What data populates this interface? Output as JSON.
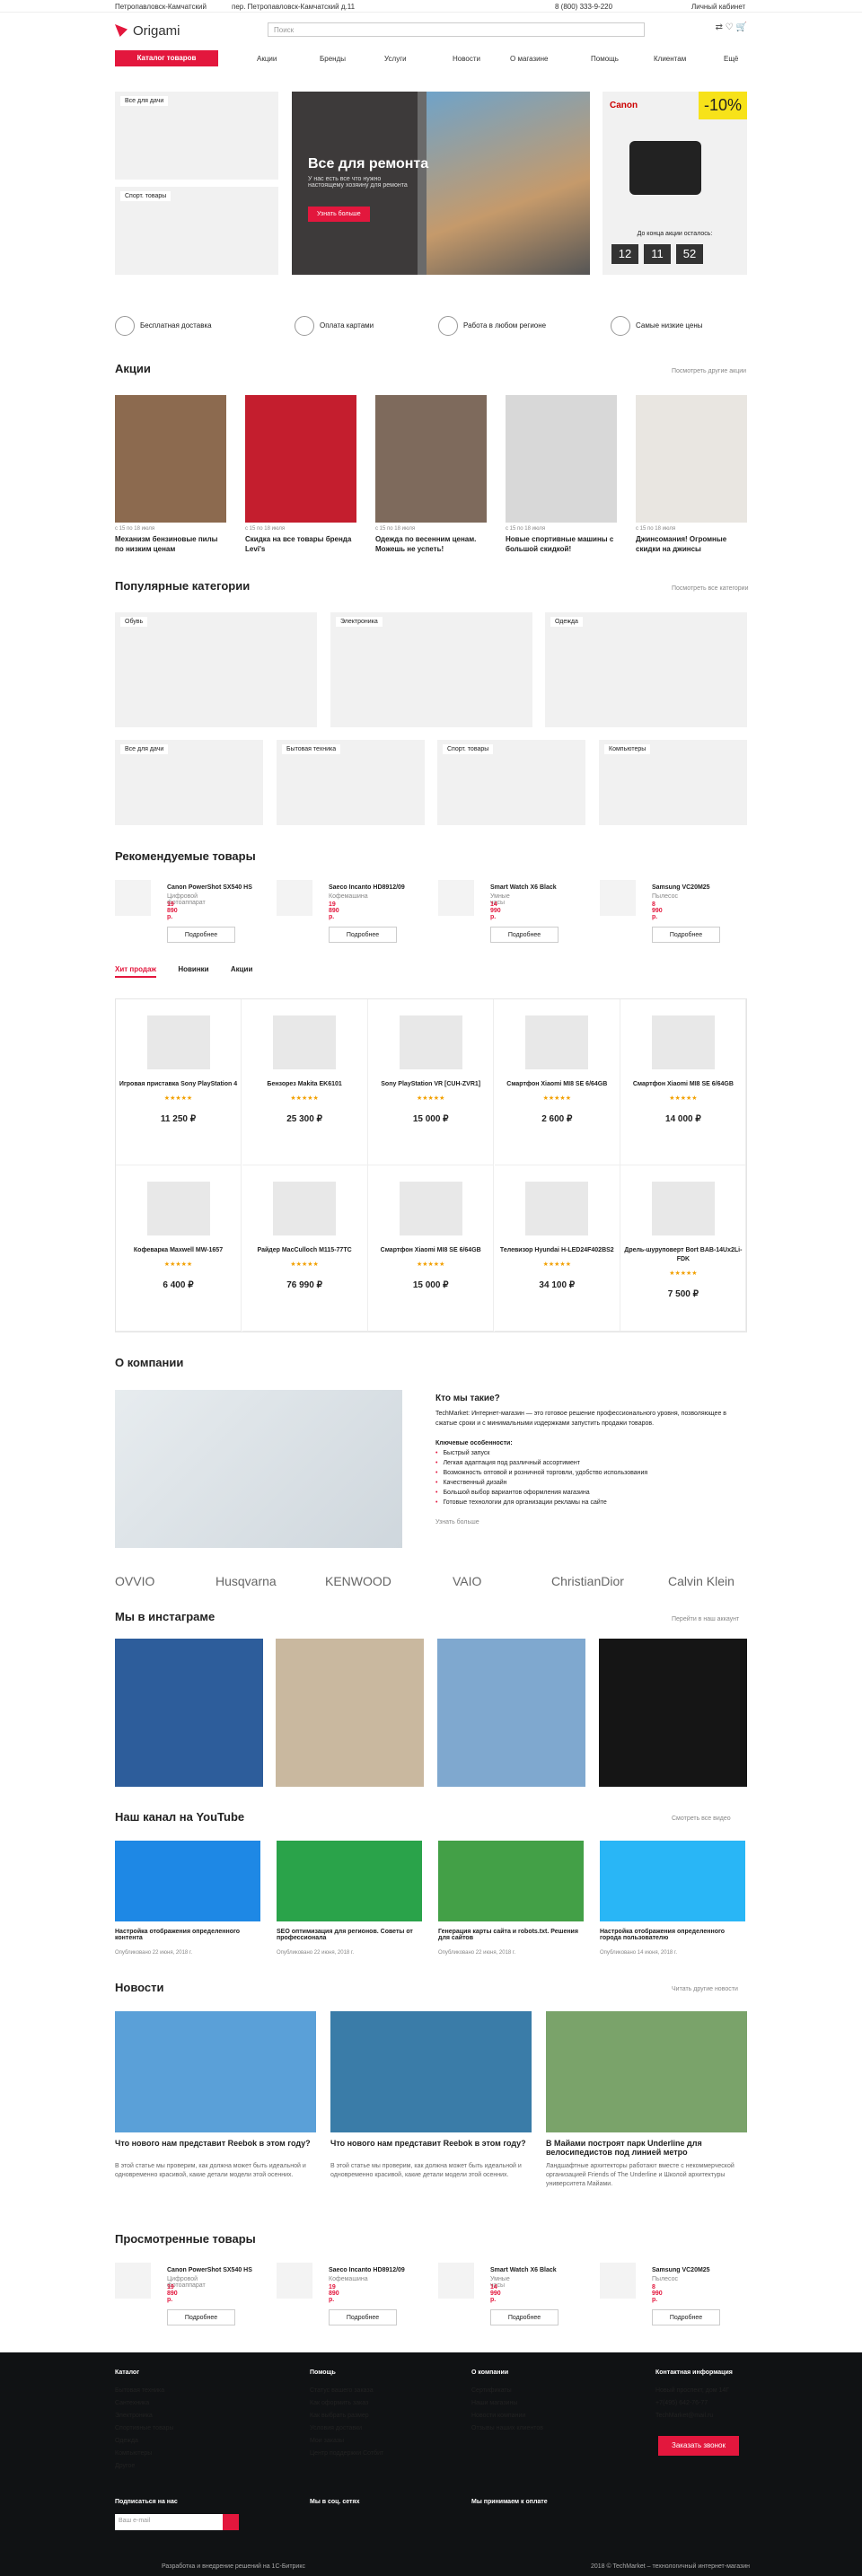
{
  "topbar": {
    "city": "Петропавловск-Камчатский",
    "address": "пер. Петропавловск-Камчатский д.11",
    "phone": "8 (800) 333-9-220",
    "cabinet": "Личный кабинет"
  },
  "header": {
    "logo": "Origami",
    "search_placeholder": "Поиск"
  },
  "nav": {
    "catalog": "Каталог товаров",
    "items": [
      "Акции",
      "Бренды",
      "Услуги",
      "Новости",
      "О магазине",
      "Помощь",
      "Клиентам",
      "Ещё"
    ]
  },
  "banners": {
    "garden": "Все для дачи",
    "sport": "Спорт. товары",
    "hero_title": "Все для ремонта",
    "hero_text": "У нас есть все что нужно настоящему хозяину для ремонта",
    "hero_btn": "Узнать больше",
    "promo_pct": "-10%",
    "promo_brand": "Canon",
    "promo_caption": "До конца акции осталось:",
    "timer": [
      "12",
      "11",
      "52"
    ],
    "timer_labels": [
      "Часов",
      "Минуты",
      "Секунды"
    ]
  },
  "features": [
    "Бесплатная доставка",
    "Оплата картами",
    "Работа в любом регионе",
    "Самые низкие цены"
  ],
  "promos": {
    "title": "Акции",
    "more": "Посмотреть другие акции",
    "items": [
      {
        "date": "с 15 по 18 июля",
        "title": "Механизм бензиновые пилы по низким ценам",
        "color": "#8c6a4f"
      },
      {
        "date": "с 15 по 18 июля",
        "title": "Скидка на все товары бренда Levi's",
        "color": "#c41e2e"
      },
      {
        "date": "с 15 по 18 июля",
        "title": "Одежда по весенним ценам. Можешь не успеть!",
        "color": "#7e6a5c"
      },
      {
        "date": "с 15 по 18 июля",
        "title": "Новые спортивные машины с большой скидкой!",
        "color": "#d8d8d8"
      },
      {
        "date": "с 15 по 18 июля",
        "title": "Джинсомания! Огромные скидки на джинсы",
        "color": "#e9e6e1"
      }
    ]
  },
  "categories": {
    "title": "Популярные категории",
    "more": "Посмотреть все категории",
    "big": [
      "Обувь",
      "Электроника",
      "Одежда"
    ],
    "small": [
      "Все для дачи",
      "Бытовая техника",
      "Спорт. товары",
      "Компьютеры"
    ]
  },
  "recommended": {
    "title": "Рекомендуемые товары",
    "btn": "Подробнее",
    "items": [
      {
        "name": "Canon PowerShot SX540 HS",
        "cat": "Цифровой фотоаппарат",
        "price": "19 890 р."
      },
      {
        "name": "Saeco Incanto HD8912/09",
        "cat": "Кофемашина",
        "price": "19 890 р."
      },
      {
        "name": "Smart Watch X6 Black",
        "cat": "Умные часы",
        "price": "14 990 р."
      },
      {
        "name": "Samsung VC20M25",
        "cat": "Пылесос",
        "price": "8 990 р."
      }
    ]
  },
  "tabs": [
    "Хит продаж",
    "Новинки",
    "Акции"
  ],
  "products": [
    {
      "name": "Игровая приставка Sony PlayStation 4",
      "price": "11 250 ₽"
    },
    {
      "name": "Бензорез Makita EK6101",
      "price": "25 300 ₽"
    },
    {
      "name": "Sony PlayStation VR [CUH-ZVR1]",
      "price": "15 000 ₽"
    },
    {
      "name": "Смартфон Xiaomi MI8 SE 6/64GB",
      "price": "2 600 ₽"
    },
    {
      "name": "Смартфон Xiaomi MI8 SE 6/64GB",
      "price": "14 000 ₽"
    },
    {
      "name": "Кофеварка Maxwell MW-1657",
      "price": "6 400 ₽"
    },
    {
      "name": "Райдер MacCulloch M115-77TC",
      "price": "76 990 ₽"
    },
    {
      "name": "Смартфон Xiaomi MI8 SE 6/64GB",
      "price": "15 000 ₽"
    },
    {
      "name": "Телевизор Hyundai H-LED24F402BS2",
      "price": "34 100 ₽"
    },
    {
      "name": "Дрель-шуруповерт Bort BAB-14Ux2Li-FDK",
      "price": "7 500 ₽"
    }
  ],
  "rating": "★★★★★",
  "about": {
    "title": "О компании",
    "h": "Кто мы такие?",
    "text": "TechMarket: Интернет-магазин — это готовое решение профессионального уровня, позволяющее в сжатые сроки и с минимальными издержками запустить продажи товаров.",
    "sub": "Ключевые особенности:",
    "bullets": [
      "Быстрый запуск",
      "Легкая адаптация под различный ассортимент",
      "Возможность оптовой и розничной торговли, удобство использования",
      "Качественный дизайн",
      "Большой выбор вариантов оформления магазина",
      "Готовые технологии для организации рекламы на сайте"
    ],
    "more": "Узнать больше"
  },
  "brands": [
    "OVVIO",
    "Husqvarna",
    "KENWOOD",
    "VAIO",
    "ChristianDior",
    "Calvin Klein"
  ],
  "instagram": {
    "title": "Мы в инстаграме",
    "more": "Перейти в наш аккаунт"
  },
  "youtube": {
    "title": "Наш канал на YouTube",
    "more": "Смотреть все видео",
    "items": [
      {
        "t": "Настройка отображения определенного контента",
        "d": "Опубликовано 22 июня, 2018 г."
      },
      {
        "t": "SEO оптимизация для регионов. Советы от профессионала",
        "d": "Опубликовано 22 июня, 2018 г."
      },
      {
        "t": "Генерация карты сайта и robots.txt. Решения для сайтов",
        "d": "Опубликовано 22 июня, 2018 г."
      },
      {
        "t": "Настройка отображения определенного города пользователю",
        "d": "Опубликовано 14 июня, 2018 г."
      }
    ]
  },
  "news": {
    "title": "Новости",
    "more": "Читать другие новости",
    "items": [
      {
        "t": "Что нового нам представит Reebok в этом году?",
        "d": "В этой статье мы проверим, как должна может быть идеальной и одновременно красивой, какие детали модели этой осенних."
      },
      {
        "t": "Что нового нам представит Reebok в этом году?",
        "d": "В этой статье мы проверим, как должна может быть идеальной и одновременно красивой, какие детали модели этой осенних."
      },
      {
        "t": "В Майами построят парк Underline для велосипедистов под линией метро",
        "d": "Ландшафтные архитекторы работают вместе с некоммерческой организацией Friends of The Underline и Школой архитектуры университета Майами."
      }
    ]
  },
  "viewed": {
    "title": "Просмотренные товары"
  },
  "footer": {
    "cols": [
      {
        "hd": "Каталог",
        "items": [
          "Бытовая техника",
          "Сантехника",
          "Электроника",
          "Спортивные товары",
          "Одежда",
          "Компьютеры",
          "Другое"
        ]
      },
      {
        "hd": "Помощь",
        "items": [
          "Статус вашего заказа",
          "Как оформить заказ",
          "Как выбрать размер",
          "Условия доставки",
          "Мои заказы",
          "Центр поддержки Сотбит"
        ]
      },
      {
        "hd": "О компании",
        "items": [
          "Сертификаты",
          "Наши магазины",
          "Новости компании",
          "Отзывы наших клиентов"
        ]
      },
      {
        "hd": "Контактная информация",
        "items": [
          "Новый проспект, дом 14Г",
          "+7(495) 642-76-77",
          "TechMarket@mail.ru"
        ]
      }
    ],
    "callback": "Заказать звонок",
    "subscribe": "Подписаться на нас",
    "email_ph": "Ваш e-mail",
    "social": "Мы в соц. сетях",
    "pay": "Мы принимаем к оплате",
    "bottom": "Разработка и внедрение решений на 1С-Битрикс",
    "copy": "2018 © TechMarket – технологичный интернет-магазин"
  }
}
